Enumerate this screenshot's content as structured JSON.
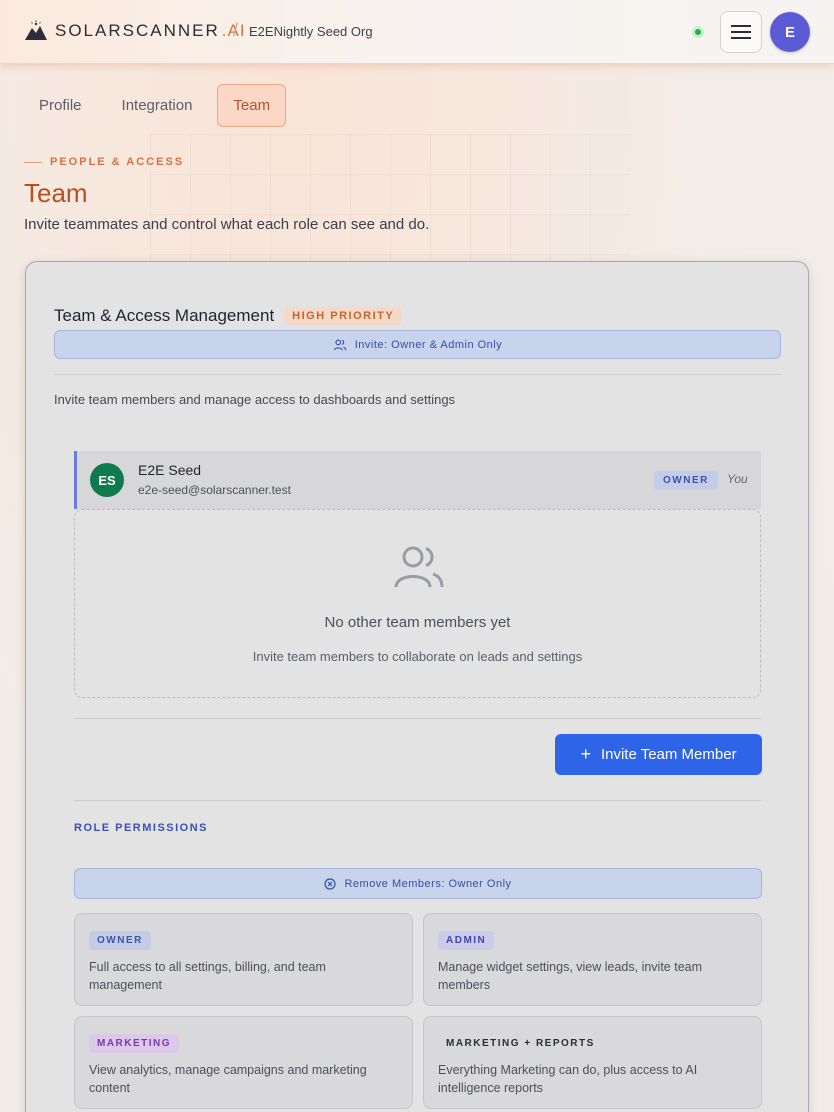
{
  "header": {
    "brand_word": "SOLARSCANNER",
    "brand_suffix": ".AI",
    "separator": "/",
    "org_name": "E2ENightly Seed Org",
    "avatar_initial": "E"
  },
  "tabs": [
    {
      "label": "Profile",
      "active": false
    },
    {
      "label": "Integration",
      "active": false
    },
    {
      "label": "Team",
      "active": true
    }
  ],
  "page": {
    "eyebrow": "PEOPLE & ACCESS",
    "title": "Team",
    "subtitle": "Invite teammates and control what each role can see and do."
  },
  "card": {
    "title": "Team & Access Management",
    "priority_badge": "HIGH PRIORITY",
    "invite_notice": "Invite: Owner & Admin Only",
    "description": "Invite team members and manage access to dashboards and settings",
    "member": {
      "initials": "ES",
      "name": "E2E Seed",
      "email": "e2e-seed@solarscanner.test",
      "role": "OWNER",
      "you_label": "You"
    },
    "empty_state": {
      "title": "No other team members yet",
      "subtitle": "Invite team members to collaborate on leads and settings"
    },
    "invite_button": "Invite Team Member",
    "role_permissions_label": "ROLE PERMISSIONS",
    "remove_notice": "Remove Members: Owner Only",
    "roles": [
      {
        "tag": "OWNER",
        "description": "Full access to all settings, billing, and team management"
      },
      {
        "tag": "ADMIN",
        "description": "Manage widget settings, view leads, invite team members"
      },
      {
        "tag": "MARKETING",
        "description": "View analytics, manage campaigns and marketing content"
      },
      {
        "tag": "MARKETING + REPORTS",
        "description": "Everything Marketing can do, plus access to AI intelligence reports"
      }
    ]
  },
  "colors": {
    "accent_orange": "#d9703f",
    "primary_blue": "#2d64e8",
    "status_green": "#1db24a",
    "avatar_purple": "#5b5bd6",
    "member_avatar_green": "#0f7a4d"
  },
  "icons": [
    "brand-logo-icon",
    "menu-icon",
    "users-icon",
    "circle-x-icon",
    "plus-icon",
    "status-dot"
  ]
}
